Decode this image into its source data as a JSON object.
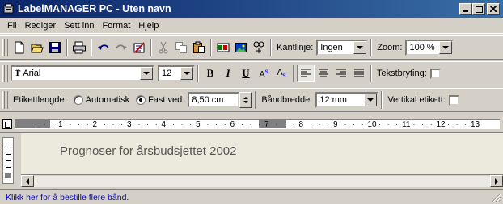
{
  "window": {
    "title": "LabelMANAGER PC - Uten navn",
    "minimize": "_",
    "maximize": "□",
    "close": "×"
  },
  "menu": [
    "Fil",
    "Rediger",
    "Sett inn",
    "Format",
    "Hjelp"
  ],
  "toolbar1": {
    "border_label": "Kantlinje:",
    "border_value": "Ingen",
    "zoom_label": "Zoom:",
    "zoom_value": "100 %"
  },
  "toolbar2": {
    "font_value": "Arial",
    "size_value": "12",
    "bold": "B",
    "italic": "I",
    "underline": "U",
    "superscript": "A",
    "superscript_mark": "s",
    "subscript": "A",
    "subscript_mark": "s",
    "wrap_label": "Tekstbryting:"
  },
  "toolbar3": {
    "label_length_label": "Etikettlengde:",
    "auto_label": "Automatisk",
    "fixed_label": "Fast ved:",
    "fixed_value": "8,50 cm",
    "tape_width_label": "Båndbredde:",
    "tape_width_value": "12 mm",
    "vertical_label": "Vertikal etikett:"
  },
  "ruler": {
    "ticks": [
      "1",
      "2",
      "3",
      "4",
      "5",
      "6",
      "7",
      "8",
      "9",
      "10",
      "11",
      "12",
      "13"
    ]
  },
  "document": {
    "text": "Prognoser for årsbudsjettet 2002"
  },
  "status": {
    "text": "Klikk her for å bestille flere bånd."
  },
  "colors": {
    "titlebar_start": "#0a246a",
    "titlebar_end": "#3a6ea5",
    "status_link": "#0000cc",
    "document_bg": "#ece9dd"
  }
}
